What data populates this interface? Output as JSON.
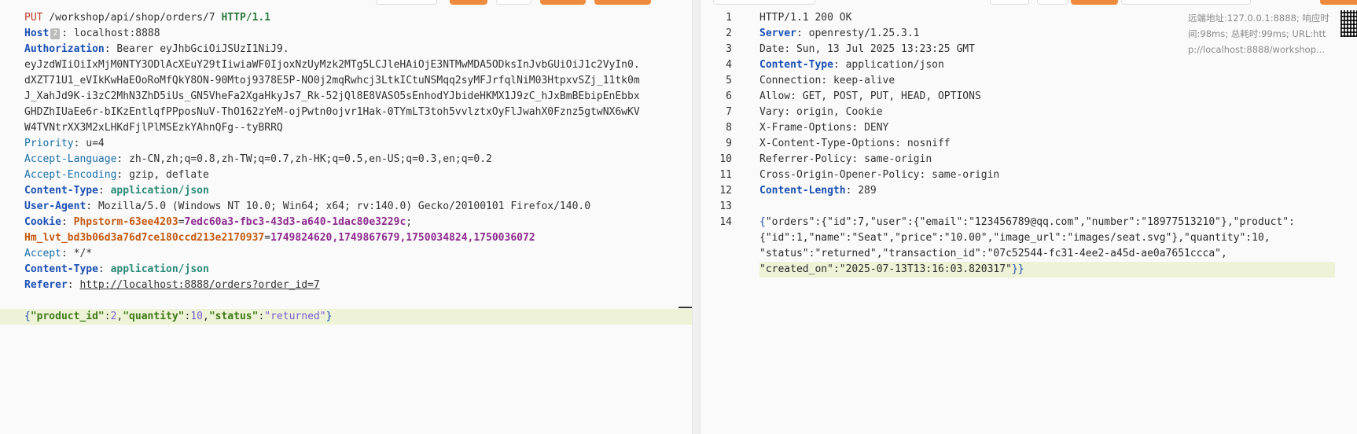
{
  "request": {
    "request_line": {
      "method": "PUT",
      "path": "/workshop/api/shop/orders/7",
      "version": "HTTP/1.1"
    },
    "host": {
      "key": "Host",
      "badge": "2",
      "value": "localhost:8888"
    },
    "authorization": {
      "key": "Authorization",
      "lines": [
        "Bearer eyJhbGciOiJSUzI1NiJ9.",
        "eyJzdWIiOiIxMjM0NTY3ODlAcXEuY29tIiwiaWF0IjoxNzUyMzk2MTg5LCJleHAiOjE3NTMwMDA5ODksInJvbGUiOiJ1c2VyIn0.",
        "dXZT71U1_eVIkKwHaEOoRoMfQkY8ON-90Mtoj9378E5P-NO0j2mqRwhcj3LtkICtuNSMqq2syMFJrfqlNiM03HtpxvSZj_11tk0m",
        "J_XahJd9K-i3zC2MhN3ZhD5iUs_GN5VheFa2XgaHkyJs7_Rk-52jQl8E8VASO5sEnhodYJbideHKMX1J9zC_hJxBmBEbipEnEbbx",
        "GHDZhIUaEe6r-bIKzEntlqfPPposNuV-ThO162zYeM-ojPwtn0ojvr1Hak-0TYmLT3toh5vvlztxOyFlJwahX0Fznz5gtwNX6wKV",
        "W4TVNtrXX3M2xLHKdFjlPlMSEzkYAhnQFg--tyBRRQ"
      ]
    },
    "priority": {
      "key": "Priority",
      "value": "u=4"
    },
    "accept_language": {
      "key": "Accept-Language",
      "value": "zh-CN,zh;q=0.8,zh-TW;q=0.7,zh-HK;q=0.5,en-US;q=0.3,en;q=0.2"
    },
    "accept_encoding": {
      "key": "Accept-Encoding",
      "value": "gzip, deflate"
    },
    "content_type_1": {
      "key": "Content-Type",
      "value": "application/json"
    },
    "user_agent": {
      "key": "User-Agent",
      "value": "Mozilla/5.0 (Windows NT 10.0; Win64; x64; rv:140.0) Gecko/20100101 Firefox/140.0"
    },
    "cookie": {
      "key": "Cookie",
      "name1": "Phpstorm-63ee4203",
      "val1": "7edc60a3-fbc3-43d3-a640-1dac80e3229c",
      "name2": "Hm_lvt_bd3b06d3a76d7ce180ccd213e2170937",
      "val2": "1749824620,1749867679,1750034824,1750036072"
    },
    "accept": {
      "key": "Accept",
      "value": "*/*"
    },
    "content_type_2": {
      "key": "Content-Type",
      "value": "application/json"
    },
    "referer": {
      "key": "Referer",
      "value": "http://localhost:8888/orders?order_id=7"
    },
    "body": {
      "k1": "\"product_id\"",
      "v1": "2",
      "k2": "\"quantity\"",
      "v2": "10",
      "k3": "\"status\"",
      "v3": "\"returned\""
    }
  },
  "response": {
    "status_line": "HTTP/1.1 200 OK",
    "headers": [
      {
        "key": "Server",
        "value": "openresty/1.25.3.1",
        "bold": true
      },
      {
        "key": "Date",
        "value": "Sun, 13 Jul 2025 13:23:25 GMT",
        "bold": false
      },
      {
        "key": "Content-Type",
        "value": "application/json",
        "bold": true
      },
      {
        "key": "Connection",
        "value": "keep-alive",
        "bold": false
      },
      {
        "key": "Allow",
        "value": "GET, POST, PUT, HEAD, OPTIONS",
        "bold": false
      },
      {
        "key": "Vary",
        "value": "origin, Cookie",
        "bold": false
      },
      {
        "key": "X-Frame-Options",
        "value": "DENY",
        "bold": false
      },
      {
        "key": "X-Content-Type-Options",
        "value": "nosniff",
        "bold": false
      },
      {
        "key": "Referrer-Policy",
        "value": "same-origin",
        "bold": false
      },
      {
        "key": "Cross-Origin-Opener-Policy",
        "value": "same-origin",
        "bold": false
      },
      {
        "key": "Content-Length",
        "value": "289",
        "bold": true
      }
    ],
    "line_numbers": [
      "1",
      "2",
      "3",
      "4",
      "5",
      "6",
      "7",
      "8",
      "9",
      "10",
      "11",
      "12",
      "13",
      "14"
    ],
    "body_lines": [
      "\"orders\":{\"id\":7,\"user\":{\"email\":\"123456789@qq.com\",\"number\":\"18977513210\"},\"product\":",
      "{\"id\":1,\"name\":\"Seat\",\"price\":\"10.00\",\"image_url\":\"images/seat.svg\"},\"quantity\":10,",
      "\"status\":\"returned\",\"transaction_id\":\"07c52544-fc31-4ee2-a45d-ae0a7651ccca\",",
      "\"created_on\":\"2025-07-13T13:16:03.820317\""
    ]
  },
  "info_panel": {
    "line1": "远端地址:127.0.0.1:8888; 响应时",
    "line2": "间:98ms; 总耗时:99ms; URL:htt",
    "line3": "p://localhost:8888/workshop..."
  }
}
